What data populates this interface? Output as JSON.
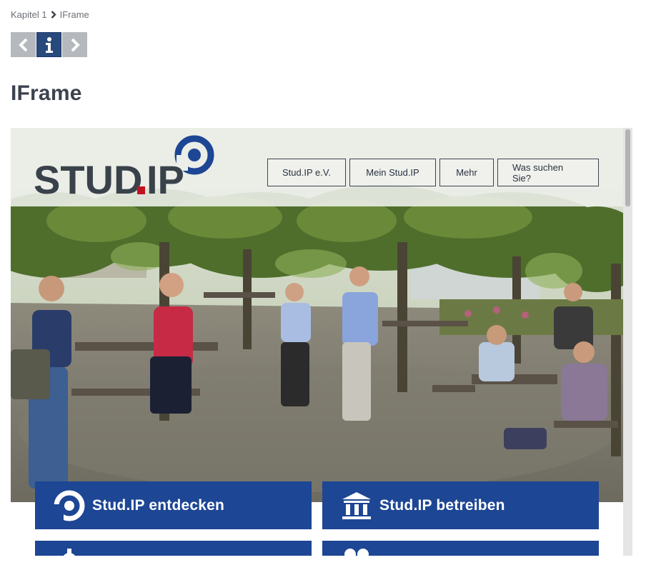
{
  "breadcrumb": {
    "items": [
      "Kapitel 1",
      "IFrame"
    ]
  },
  "navigation": {
    "prev_icon": "chevron-left-icon",
    "info_icon": "info-icon",
    "next_icon": "chevron-right-icon"
  },
  "page": {
    "title": "IFrame"
  },
  "iframe": {
    "logo": {
      "text_main": "STUD",
      "text_dot": ".",
      "text_end": "IP"
    },
    "topnav": [
      "Stud.IP e.V.",
      "Mein Stud.IP",
      "Mehr",
      "Was suchen Sie?"
    ],
    "tiles": [
      {
        "label": "Stud.IP entdecken",
        "icon": "studip-ring-icon"
      },
      {
        "label": "Stud.IP betreiben",
        "icon": "building-columns-icon"
      },
      {
        "label": "",
        "icon": "gear-icon"
      },
      {
        "label": "",
        "icon": "people-icon"
      }
    ]
  },
  "colors": {
    "brand_blue": "#1d4694",
    "logo_red": "#c1121f",
    "text_dark": "#3c434e",
    "header_bg": "#eceee9"
  }
}
